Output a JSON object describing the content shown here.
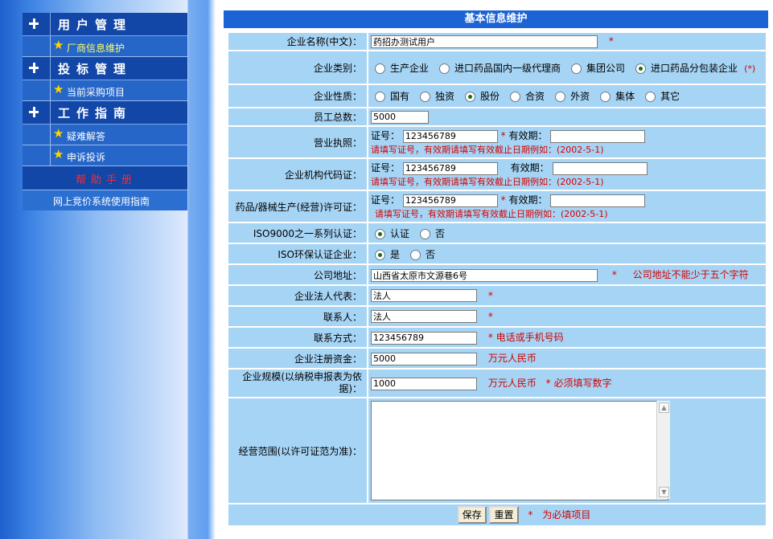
{
  "menu": {
    "groups": [
      {
        "title": "用户管理",
        "items": [
          {
            "label": "厂商信息维护",
            "selected": true
          }
        ]
      },
      {
        "title": "投标管理",
        "items": [
          {
            "label": "当前采购项目",
            "selected": false
          }
        ]
      },
      {
        "title": "工作指南",
        "items": [
          {
            "label": "疑难解答",
            "selected": false
          },
          {
            "label": "申诉投诉",
            "selected": false
          }
        ]
      }
    ],
    "help_label": "帮助手册",
    "guide_label": "网上竞价系统使用指南"
  },
  "form": {
    "title": "基本信息维护",
    "company_name": {
      "label": "企业名称(中文)：",
      "value": "药招办测试用户",
      "required": "*"
    },
    "company_type": {
      "label": "企业类别：",
      "options": [
        "生产企业",
        "进口药品国内一级代理商",
        "集团公司",
        "进口药品分包装企业"
      ],
      "selected": 3,
      "note": "(*)"
    },
    "company_nature": {
      "label": "企业性质：",
      "options": [
        "国有",
        "独资",
        "股份",
        "合资",
        "外资",
        "集体",
        "其它"
      ],
      "selected": 2
    },
    "employees": {
      "label": "员工总数：",
      "value": "5000"
    },
    "business_license": {
      "label": "营业执照：",
      "cert_label": "证号：",
      "cert_value": "123456789",
      "required": "*",
      "expiry_label": "有效期：",
      "expiry_value": "",
      "hint": "请填写证号，有效期请填写有效截止日期例如：(2002-5-1)"
    },
    "org_code": {
      "label": "企业机构代码证：",
      "cert_label": "证号：",
      "cert_value": "123456789",
      "expiry_label": "有效期：",
      "expiry_value": "",
      "hint": "请填写证号，有效期请填写有效截止日期例如：(2002-5-1)"
    },
    "production_license": {
      "label": "药品/器械生产(经营)许可证：",
      "cert_label": "证号：",
      "cert_value": "123456789",
      "required": "*",
      "expiry_label": "有效期：",
      "expiry_value": "",
      "hint": "请填写证号，有效期请填写有效截止日期例如：(2002-5-1)"
    },
    "iso9000": {
      "label": "ISO9000之一系列认证：",
      "options": [
        "认证",
        "否"
      ],
      "selected": 0
    },
    "iso_env": {
      "label": "ISO环保认证企业：",
      "options": [
        "是",
        "否"
      ],
      "selected": 0
    },
    "address": {
      "label": "公司地址：",
      "value": "山西省太原市文源巷6号",
      "required": "*",
      "hint": "公司地址不能少于五个字符"
    },
    "legal_rep": {
      "label": "企业法人代表：",
      "value": "法人",
      "required": "*"
    },
    "contact": {
      "label": "联系人：",
      "value": "法人",
      "required": "*"
    },
    "contact_method": {
      "label": "联系方式：",
      "value": "123456789",
      "hint": "* 电话或手机号码"
    },
    "capital": {
      "label": "企业注册资金：",
      "value": "5000",
      "unit": "万元人民币"
    },
    "scale": {
      "label": "企业规模(以纳税申报表为依据)：",
      "value": "1000",
      "unit": "万元人民币",
      "hint": "* 必须填写数字"
    },
    "scope": {
      "label": "经营范围(以许可证范为准)：",
      "value": ""
    },
    "buttons": {
      "save": "保存",
      "reset": "重置",
      "required_note": "*　为必填项目"
    }
  },
  "colors": {
    "menu_group_bg": "#1246a7",
    "menu_item_bg": "#2566c8",
    "form_header_bg": "#1c63d5",
    "form_cell_bg": "#a6d4f5",
    "required_red": "#d40000"
  }
}
